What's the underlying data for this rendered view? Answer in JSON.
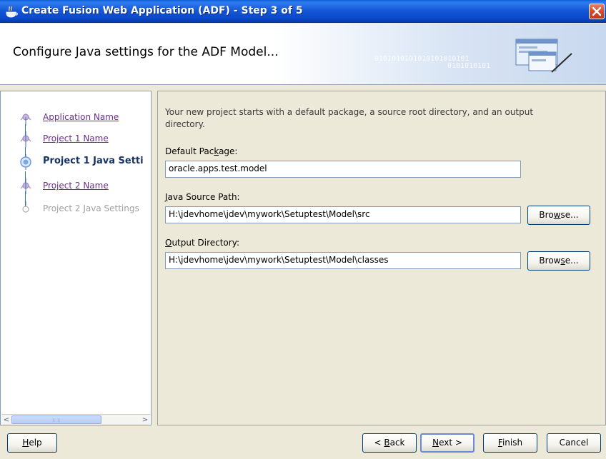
{
  "window": {
    "title": "Create Fusion Web Application (ADF) - Step 3 of 5"
  },
  "header": {
    "title": "Configure Java settings for the ADF Model...",
    "binary_line1": "0101010101010101010101",
    "binary_line2": "0101010101"
  },
  "nav": {
    "items": [
      {
        "label": "Application Name",
        "state": "visited"
      },
      {
        "label": "Project 1 Name",
        "state": "visited"
      },
      {
        "label": "Project 1 Java Setti",
        "state": "current"
      },
      {
        "label": "Project 2 Name",
        "state": "visited"
      },
      {
        "label": "Project 2 Java Settings",
        "state": "disabled"
      }
    ]
  },
  "content": {
    "description": "Your new project starts with a default package, a source root directory, and an output directory.",
    "default_package": {
      "label_pre": "Default Pac",
      "label_mn": "k",
      "label_post": "age:",
      "value": "oracle.apps.test.model"
    },
    "java_source": {
      "label_mn": "J",
      "label_post": "ava Source Path:",
      "value": "H:\\jdevhome\\jdev\\mywork\\Setuptest\\Model\\src",
      "browse_pre": "Bro",
      "browse_mn": "w",
      "browse_post": "se..."
    },
    "output_dir": {
      "label_mn": "O",
      "label_post": "utput Directory:",
      "value": "H:\\jdevhome\\jdev\\mywork\\Setuptest\\Model\\classes",
      "browse_pre": "Brow",
      "browse_mn": "s",
      "browse_post": "e..."
    }
  },
  "footer": {
    "help_mn": "H",
    "help_post": "elp",
    "back_pre": "< ",
    "back_mn": "B",
    "back_post": "ack",
    "next_mn": "N",
    "next_post": "ext >",
    "finish_mn": "F",
    "finish_post": "inish",
    "cancel_label": "Cancel"
  },
  "colors": {
    "titlebar": "#1457D6",
    "link_visited": "#6B2D8F",
    "current_step": "#153268",
    "window_bg": "#ECE9D8"
  }
}
